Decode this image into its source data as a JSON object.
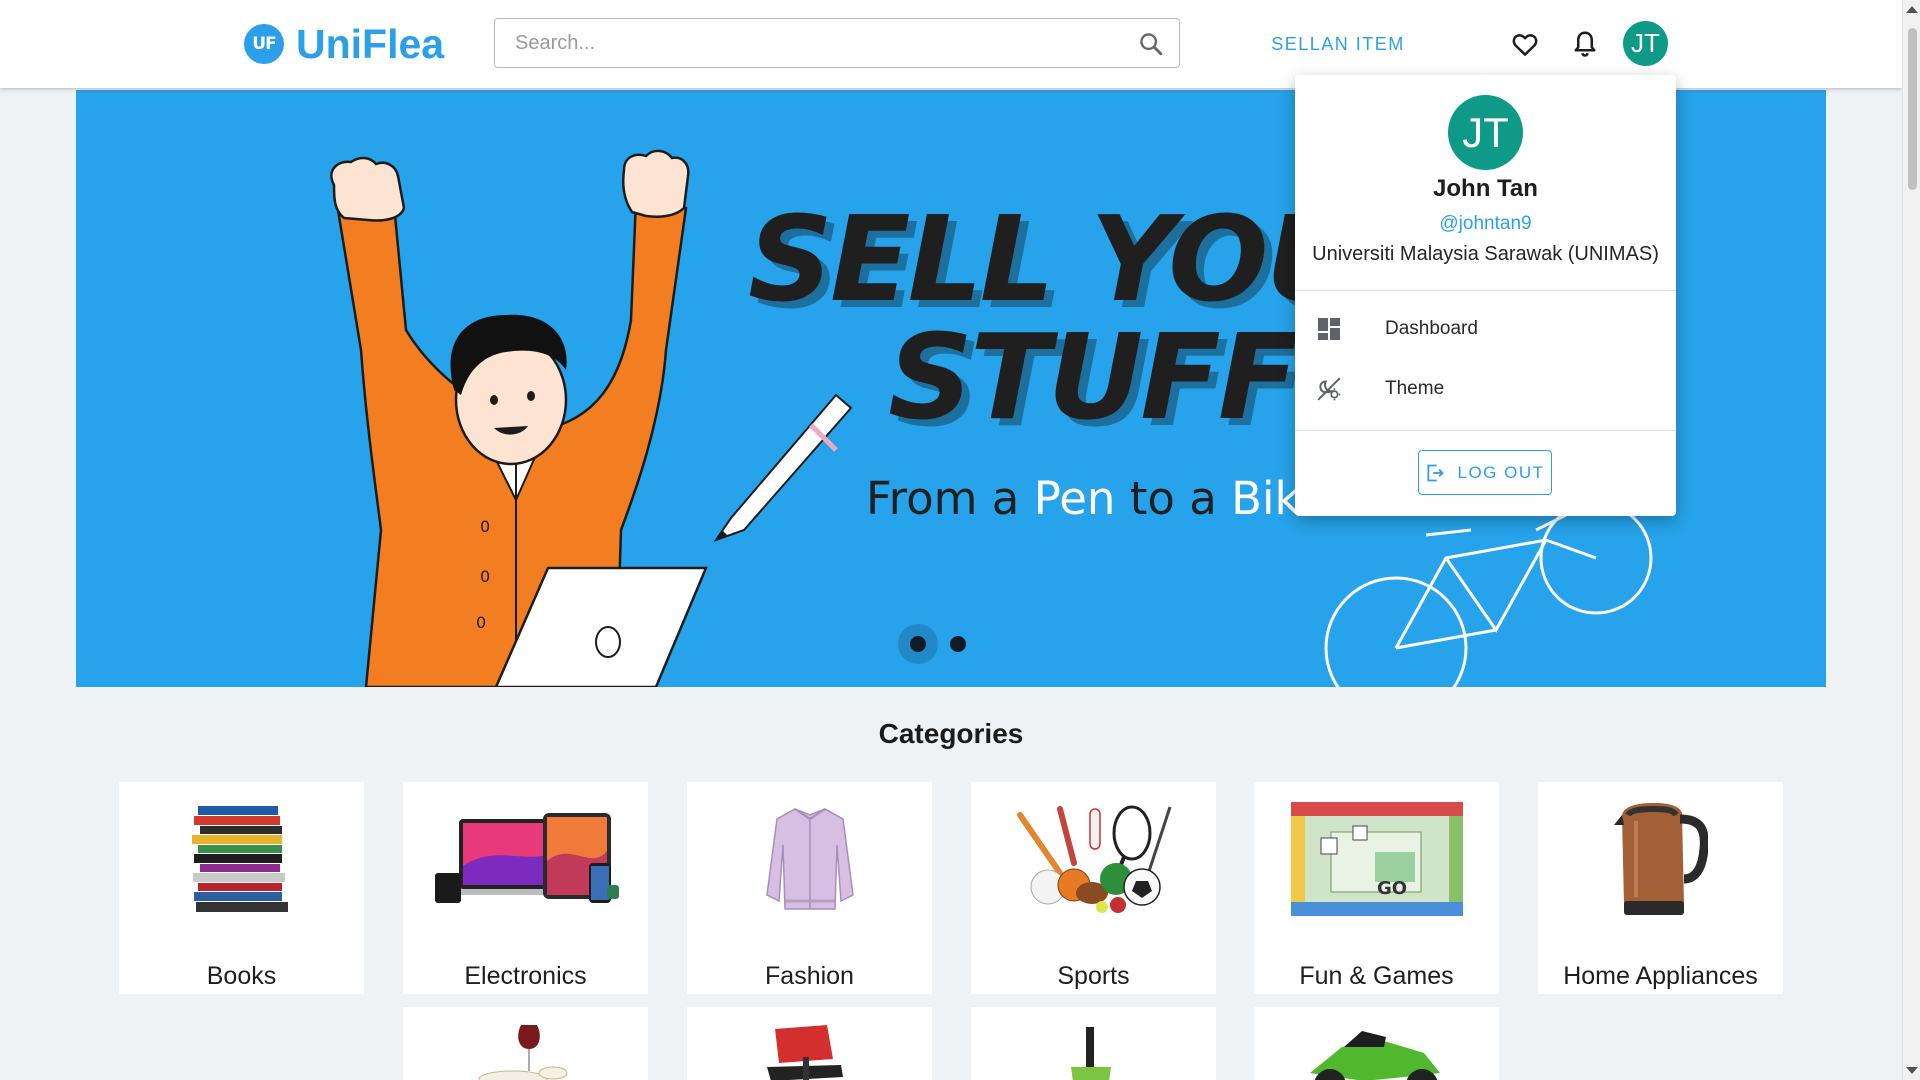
{
  "header": {
    "logo_mark": "UF",
    "logo_text": "UniFlea",
    "search_placeholder": "Search...",
    "sell_label": "SELLAN ITEM"
  },
  "user": {
    "initials": "JT",
    "name": "John Tan",
    "handle": "@johntan9",
    "university": "Universiti Malaysia Sarawak (UNIMAS)"
  },
  "menu": {
    "items": [
      {
        "label": "Dashboard",
        "icon": "dashboard-icon"
      },
      {
        "label": "Theme",
        "icon": "theme-icon"
      }
    ],
    "logout_label": "LOG OUT"
  },
  "hero": {
    "title_line1": "SELL YOU",
    "title_line2": "STUFF",
    "sub_1": "From a ",
    "sub_2": "Pen",
    "sub_3": " to a ",
    "sub_4": "Bik",
    "slides": 2,
    "active_slide": 1
  },
  "categories": {
    "title": "Categories",
    "items": [
      {
        "label": "Books",
        "icon": "books-image"
      },
      {
        "label": "Electronics",
        "icon": "electronics-image"
      },
      {
        "label": "Fashion",
        "icon": "jacket-image"
      },
      {
        "label": "Sports",
        "icon": "sports-equipment-image"
      },
      {
        "label": "Fun & Games",
        "icon": "board-game-image"
      },
      {
        "label": "Home Appliances",
        "icon": "kettle-image"
      }
    ],
    "second_row_icons": [
      "tableware-image",
      "office-chair-image",
      "gardening-tool-image",
      "motorcycle-image"
    ]
  },
  "colors": {
    "brand": "#2ba0e8",
    "avatar": "#0f9a88",
    "hero_bg": "#26a3ea",
    "page_bg": "#eff2f5"
  }
}
